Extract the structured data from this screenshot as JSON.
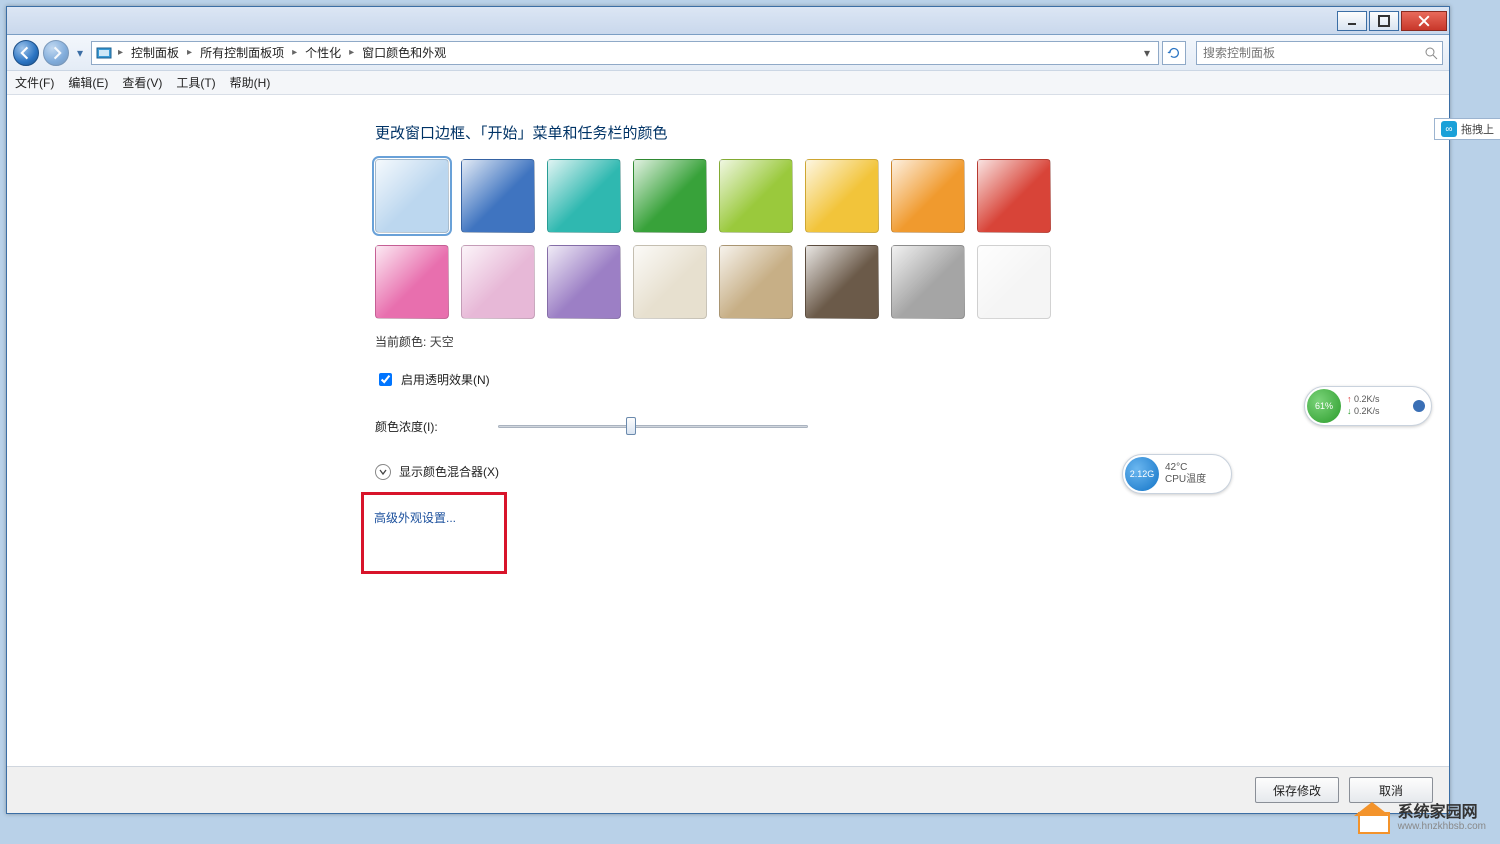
{
  "titlebar": {},
  "breadcrumb": {
    "items": [
      "控制面板",
      "所有控制面板项",
      "个性化",
      "窗口颜色和外观"
    ]
  },
  "search": {
    "placeholder": "搜索控制面板"
  },
  "menu": {
    "file": "文件(F)",
    "edit": "编辑(E)",
    "view": "查看(V)",
    "tools": "工具(T)",
    "help": "帮助(H)"
  },
  "page": {
    "heading": "更改窗口边框、「开始」菜单和任务栏的颜色",
    "current_label": "当前颜色:",
    "current_value": "天空",
    "transparency_label": "启用透明效果(N)",
    "intensity_label": "颜色浓度(I):",
    "mixer_label": "显示颜色混合器(X)",
    "advanced_link": "高级外观设置..."
  },
  "colors": {
    "row1": [
      "#bcd7ef",
      "#3f74c0",
      "#2fb8b0",
      "#38a23a",
      "#9ac93c",
      "#f2c43a",
      "#f09a2e",
      "#d84438"
    ],
    "row2": [
      "#e86fae",
      "#e7b8d7",
      "#9c7fc5",
      "#e7e0cf",
      "#c7af86",
      "#6b5a49",
      "#a5a5a5",
      "#f5f5f5"
    ]
  },
  "footer": {
    "save": "保存修改",
    "cancel": "取消"
  },
  "widgets": {
    "cpu_value": "2.12G",
    "cpu_temp": "42°C",
    "cpu_label": "CPU温度",
    "net_pct": "61%",
    "net_up": "0.2K/s",
    "net_dn": "0.2K/s"
  },
  "side_tab": "拖拽上",
  "watermark": {
    "title": "系统家园网",
    "url": "www.hnzkhbsb.com"
  }
}
